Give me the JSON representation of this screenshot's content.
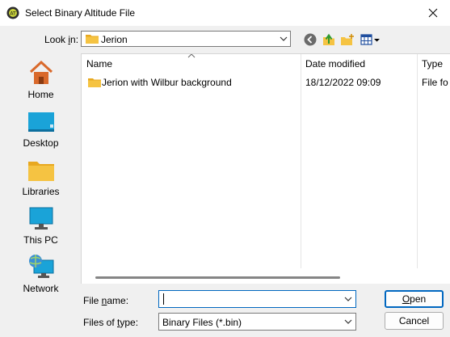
{
  "window": {
    "title": "Select Binary Altitude File",
    "icon": "app-icon"
  },
  "lookin": {
    "label_pre": "Look ",
    "label_accel": "i",
    "label_post": "n:",
    "value": "Jerion"
  },
  "toolbar": {
    "icons": [
      "back-icon",
      "up-folder-icon",
      "new-folder-icon",
      "view-menu-icon"
    ]
  },
  "places": [
    {
      "label": "Home",
      "icon": "home-icon"
    },
    {
      "label": "Desktop",
      "icon": "desktop-icon"
    },
    {
      "label": "Libraries",
      "icon": "libraries-icon"
    },
    {
      "label": "This PC",
      "icon": "this-pc-icon"
    },
    {
      "label": "Network",
      "icon": "network-icon"
    }
  ],
  "filelist": {
    "columns": [
      "Name",
      "Date modified",
      "Type"
    ],
    "rows": [
      {
        "name": "Jerion with Wilbur background",
        "date": "18/12/2022 09:09",
        "type": "File fo"
      }
    ]
  },
  "filename": {
    "label_pre": "File ",
    "label_accel": "n",
    "label_post": "ame:",
    "value": ""
  },
  "filetype": {
    "label_pre": "Files of ",
    "label_accel": "t",
    "label_post": "ype:",
    "value": "Binary Files (*.bin)"
  },
  "buttons": {
    "open_accel": "O",
    "open_rest": "pen",
    "cancel": "Cancel"
  },
  "colors": {
    "accent": "#0067c0",
    "folder": "#f5c342"
  }
}
